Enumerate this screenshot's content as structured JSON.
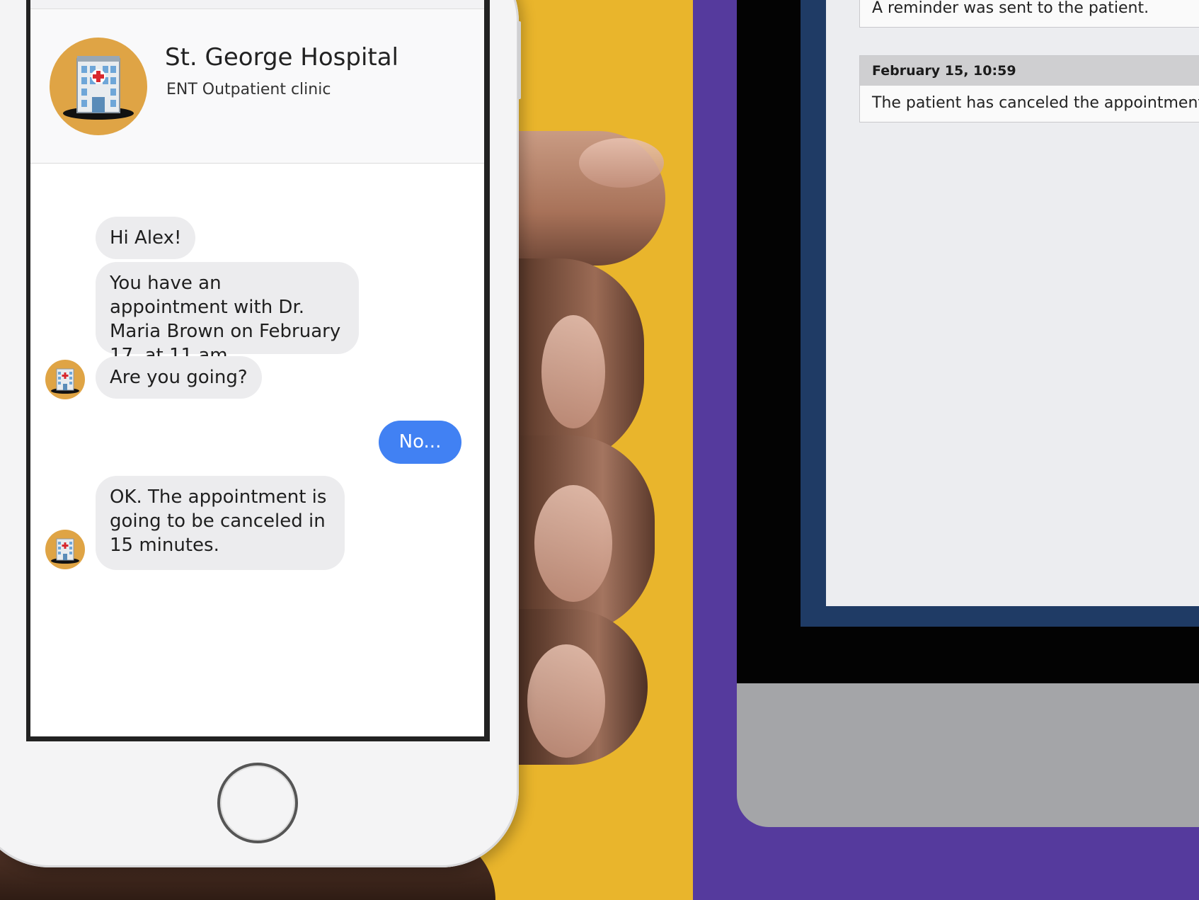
{
  "phone_chat": {
    "header": {
      "title": "St. George Hospital",
      "subtitle": "ENT Outpatient clinic",
      "avatar_icon": "hospital-building-icon"
    },
    "messages": [
      {
        "sender": "hospital",
        "text": "Hi Alex!"
      },
      {
        "sender": "hospital",
        "text": "You have an appointment with Dr. Maria Brown on February 17, at 11 am."
      },
      {
        "sender": "hospital",
        "text": "Are you going?"
      },
      {
        "sender": "user",
        "text": "No..."
      },
      {
        "sender": "hospital",
        "text": "OK. The appointment is going to be canceled in 15 minutes."
      }
    ],
    "colors": {
      "user_bubble": "#4181f3",
      "hospital_bubble": "#ececee",
      "logo_bg": "#dfa445"
    }
  },
  "desktop_log": {
    "entries": [
      {
        "timestamp": "",
        "text": "A reminder was sent to the patient."
      },
      {
        "timestamp": "February 15, 10:59",
        "text": "The patient has canceled the appointment."
      }
    ]
  },
  "backgrounds": {
    "left": "#e9b52c",
    "right": "#553a9d"
  }
}
